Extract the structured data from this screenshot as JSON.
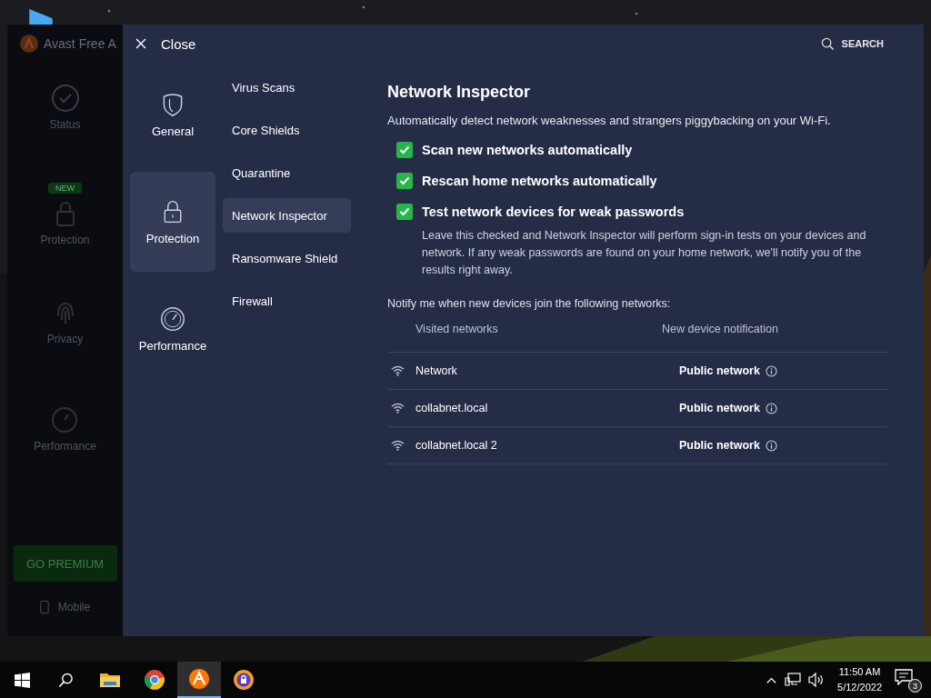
{
  "background_app": {
    "title": "Avast Free A",
    "nav": [
      {
        "label": "Status",
        "kind": "status"
      },
      {
        "label": "Protection",
        "kind": "protection",
        "badge": "NEW"
      },
      {
        "label": "Privacy",
        "kind": "privacy"
      },
      {
        "label": "Performance",
        "kind": "performance"
      }
    ],
    "premium_button": "GO PREMIUM",
    "mobile": "Mobile"
  },
  "settings": {
    "close": "Close",
    "search": "SEARCH",
    "categories": [
      {
        "label": "General",
        "kind": "shield",
        "selected": false
      },
      {
        "label": "Protection",
        "kind": "lock",
        "selected": true
      },
      {
        "label": "Performance",
        "kind": "gauge",
        "selected": false
      }
    ],
    "subnav": [
      {
        "label": "Virus Scans",
        "selected": false
      },
      {
        "label": "Core Shields",
        "selected": false
      },
      {
        "label": "Quarantine",
        "selected": false
      },
      {
        "label": "Network Inspector",
        "selected": true
      },
      {
        "label": "Ransomware Shield",
        "selected": false
      },
      {
        "label": "Firewall",
        "selected": false
      }
    ],
    "heading": "Network Inspector",
    "description": "Automatically detect network weaknesses and strangers piggybacking on your Wi-Fi.",
    "options": [
      {
        "label": "Scan new networks automatically",
        "checked": true
      },
      {
        "label": "Rescan home networks automatically",
        "checked": true
      },
      {
        "label": "Test network devices for weak passwords",
        "checked": true,
        "note": "Leave this checked and Network Inspector will perform sign-in tests on your devices and network. If any weak passwords are found on your home network, we'll notify you of the results right away."
      }
    ],
    "notify_label": "Notify me when new devices join the following networks:",
    "table": {
      "columns": [
        "Visited networks",
        "New device notification"
      ],
      "rows": [
        {
          "network": "Network",
          "notification": "Public network"
        },
        {
          "network": "collabnet.local",
          "notification": "Public network"
        },
        {
          "network": "collabnet.local 2",
          "notification": "Public network"
        }
      ]
    }
  },
  "taskbar": {
    "apps": [
      {
        "kind": "folder",
        "selected": false
      },
      {
        "kind": "chrome",
        "selected": false
      },
      {
        "kind": "avast",
        "selected": true
      },
      {
        "kind": "secure-browser",
        "selected": false
      }
    ],
    "time": "11:50 AM",
    "date": "5/12/2022",
    "notifications": "3"
  }
}
